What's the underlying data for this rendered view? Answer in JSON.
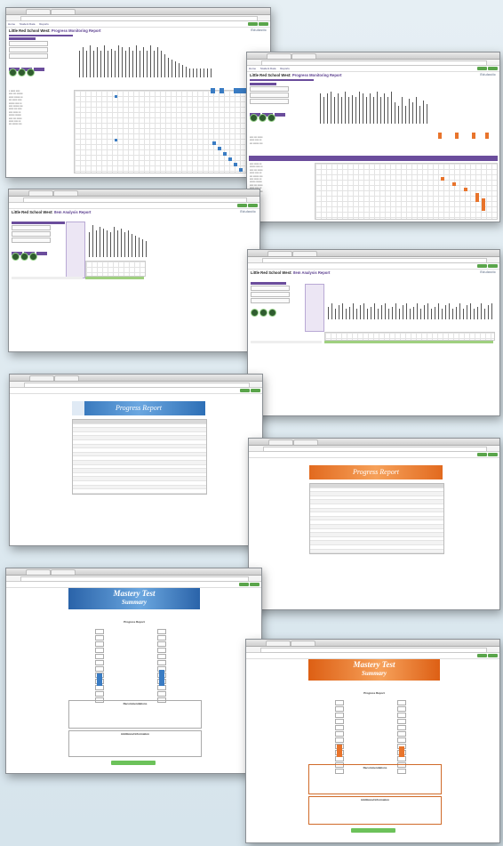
{
  "windows": {
    "monitoring_1": {
      "title_prefix": "Little Red School West:",
      "title": "Progress Monitoring Report",
      "nav": [
        "Home",
        "Student Data",
        "Reports"
      ],
      "logo": "Edulastic"
    },
    "monitoring_2": {
      "title_prefix": "Little Red School West:",
      "title": "Progress Monitoring Report",
      "nav": [
        "Home",
        "Student Data",
        "Reports"
      ],
      "logo": "Edulastic"
    },
    "item_analysis_1": {
      "title_prefix": "Little Red School West:",
      "title": "Item Analysis Report",
      "logo": "Edulastic"
    },
    "item_analysis_2": {
      "title_prefix": "Little Red School West:",
      "title": "Item Analysis Report",
      "logo": "Edulastic"
    },
    "progress_blue": {
      "banner": "Progress Report"
    },
    "progress_orange": {
      "banner": "Progress Report"
    },
    "mastery_blue": {
      "banner_line1": "Mastery Test",
      "banner_line2": "Summary",
      "section_1": "Progress Report",
      "section_2": "Recommendations",
      "section_3": "Additional Information"
    },
    "mastery_orange": {
      "banner_line1": "Mastery Test",
      "banner_line2": "Summary",
      "section_1": "Progress Report",
      "section_2": "Recommendations",
      "section_3": "Additional Information"
    }
  },
  "colors": {
    "accent_purple": "#6b4d9c",
    "mark_blue": "#3a7cc3",
    "mark_orange": "#e8742c",
    "button_green": "#5aa54b"
  }
}
